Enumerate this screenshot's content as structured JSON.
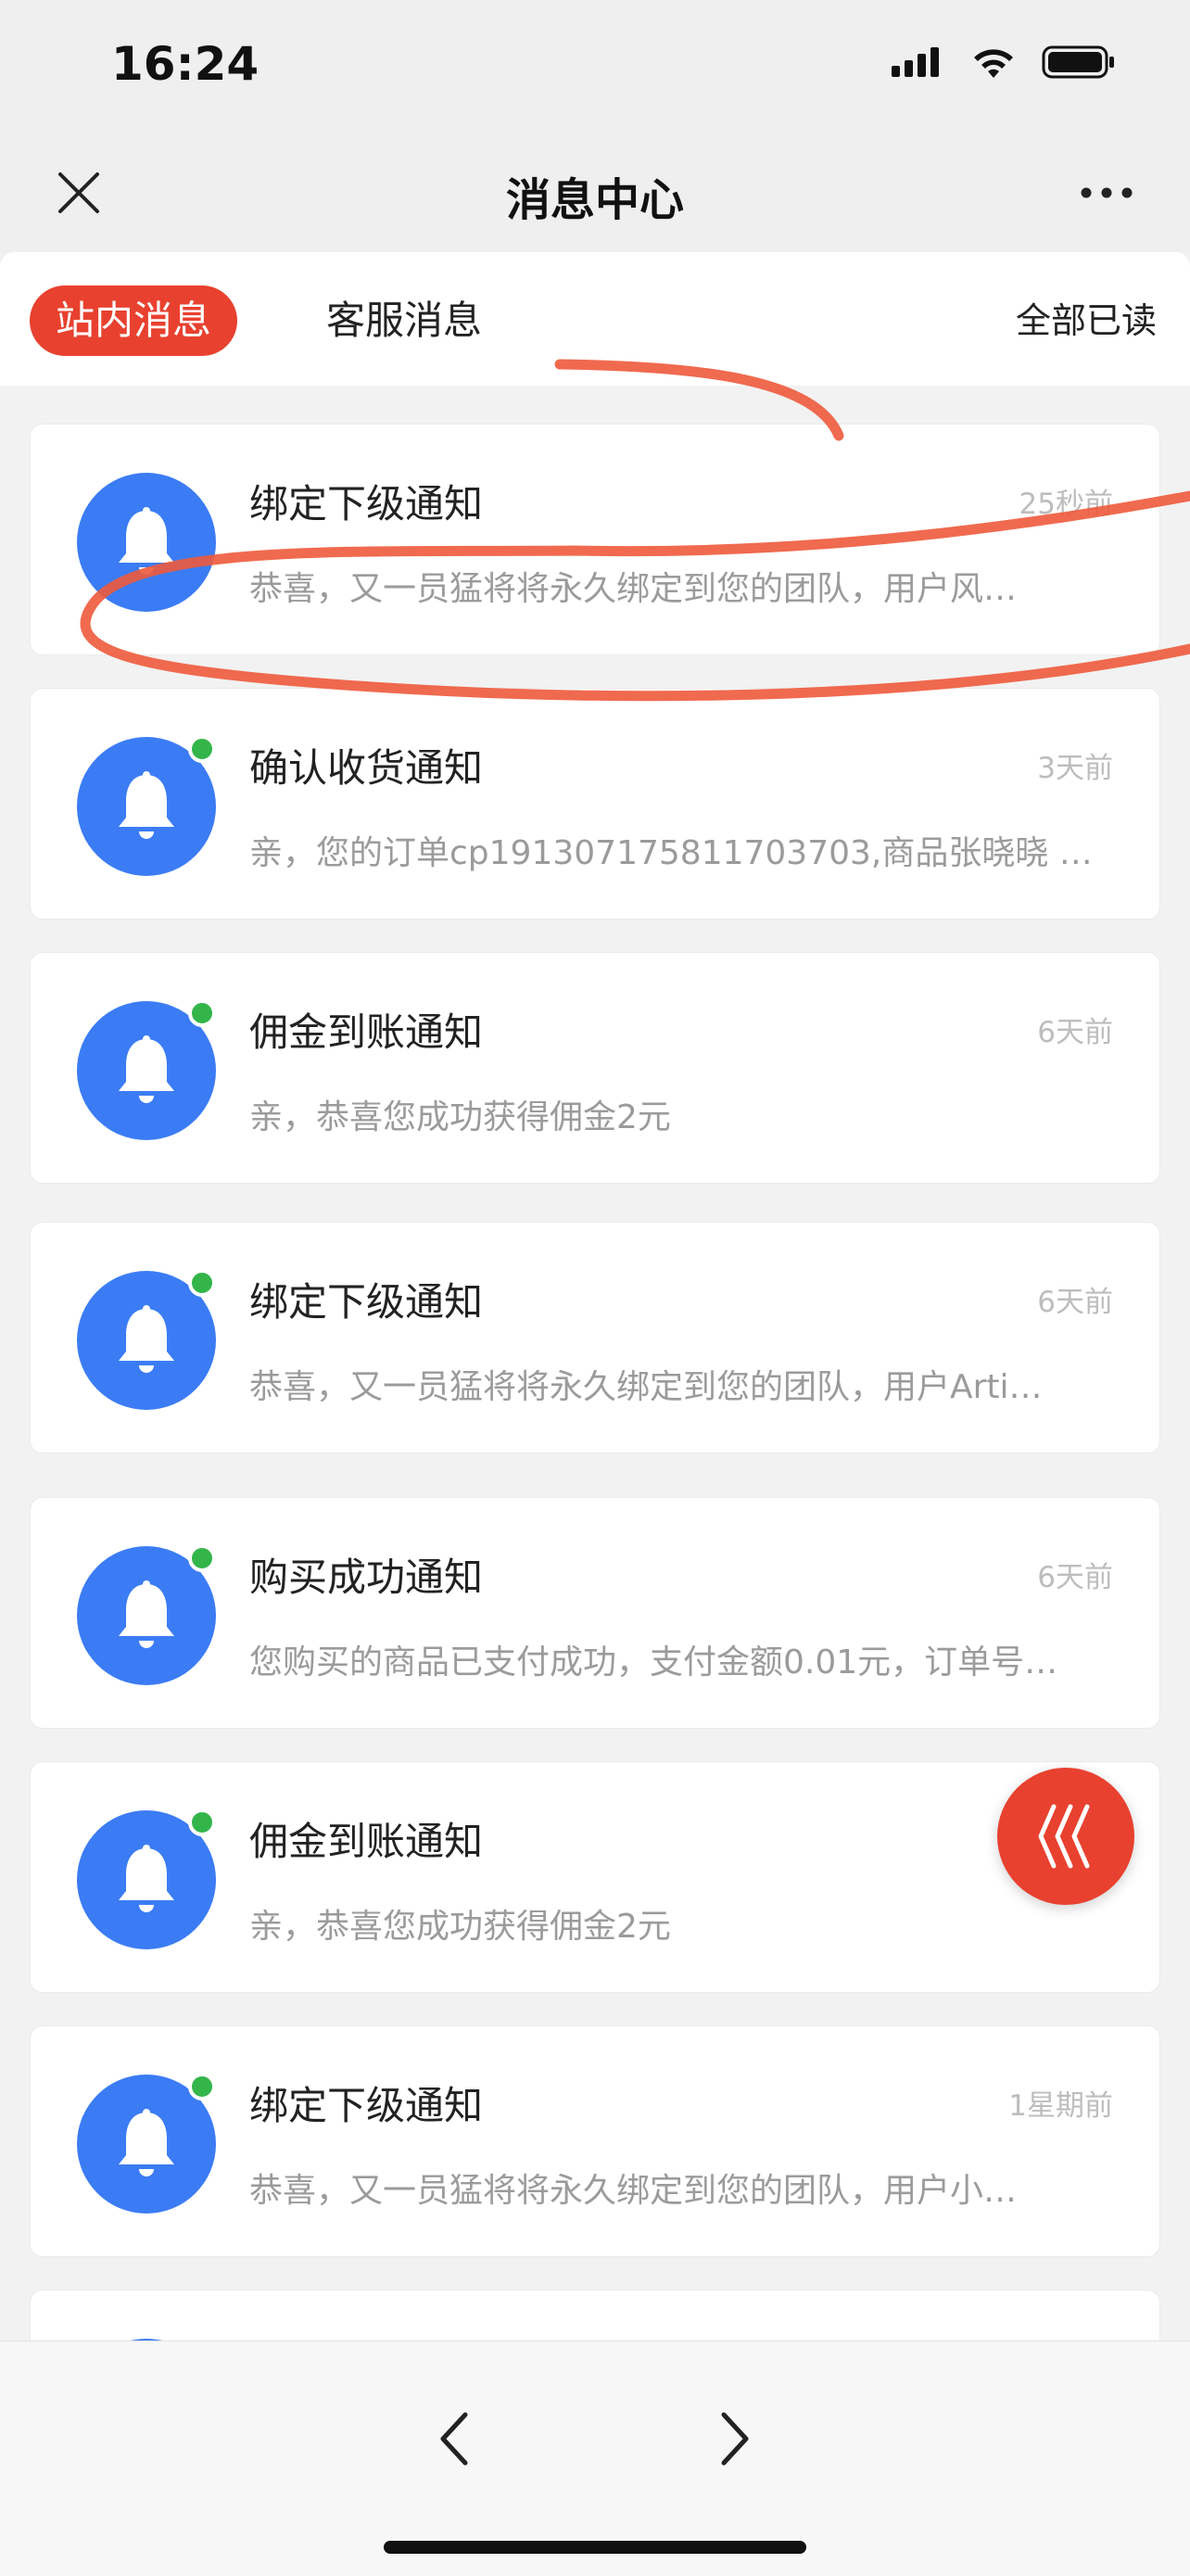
{
  "status_bar": {
    "time": "16:24",
    "icons": [
      "signal-icon",
      "wifi-icon",
      "battery-icon"
    ]
  },
  "nav": {
    "title": "消息中心",
    "close_icon": "close-icon",
    "more_icon": "more-icon"
  },
  "tabs": {
    "active_label": "站内消息",
    "inactive_label": "客服消息",
    "mark_all_label": "全部已读",
    "accent_color": "#e8412f"
  },
  "messages": [
    {
      "title": "绑定下级通知",
      "time": "25秒前",
      "body": "恭喜，又一员猛将将永久绑定到您的团队，用户风…",
      "unread": false
    },
    {
      "title": "确认收货通知",
      "time": "3天前",
      "body": "亲，您的订单cp191307175811703703,商品张晓晓 …",
      "unread": true
    },
    {
      "title": "佣金到账通知",
      "time": "6天前",
      "body": "亲，恭喜您成功获得佣金2元",
      "unread": true
    },
    {
      "title": "绑定下级通知",
      "time": "6天前",
      "body": "恭喜，又一员猛将将永久绑定到您的团队，用户Arti…",
      "unread": true
    },
    {
      "title": "购买成功通知",
      "time": "6天前",
      "body": "您购买的商品已支付成功，支付金额0.01元，订单号…",
      "unread": true
    },
    {
      "title": "佣金到账通知",
      "time": "",
      "body": "亲，恭喜您成功获得佣金2元",
      "unread": true
    },
    {
      "title": "绑定下级通知",
      "time": "1星期前",
      "body": "恭喜，又一员猛将将永久绑定到您的团队，用户小…",
      "unread": true
    },
    {
      "title": "",
      "time": "",
      "body": "",
      "unread": true
    }
  ],
  "colors": {
    "avatar_bg": "#3b7cf4",
    "unread_dot": "#33b54a",
    "annotation_stroke": "#ee5a3c"
  },
  "float_button": {
    "icon": "wave-lines-icon"
  },
  "bottom_bar": {
    "back_icon": "chevron-left-icon",
    "forward_icon": "chevron-right-icon"
  }
}
